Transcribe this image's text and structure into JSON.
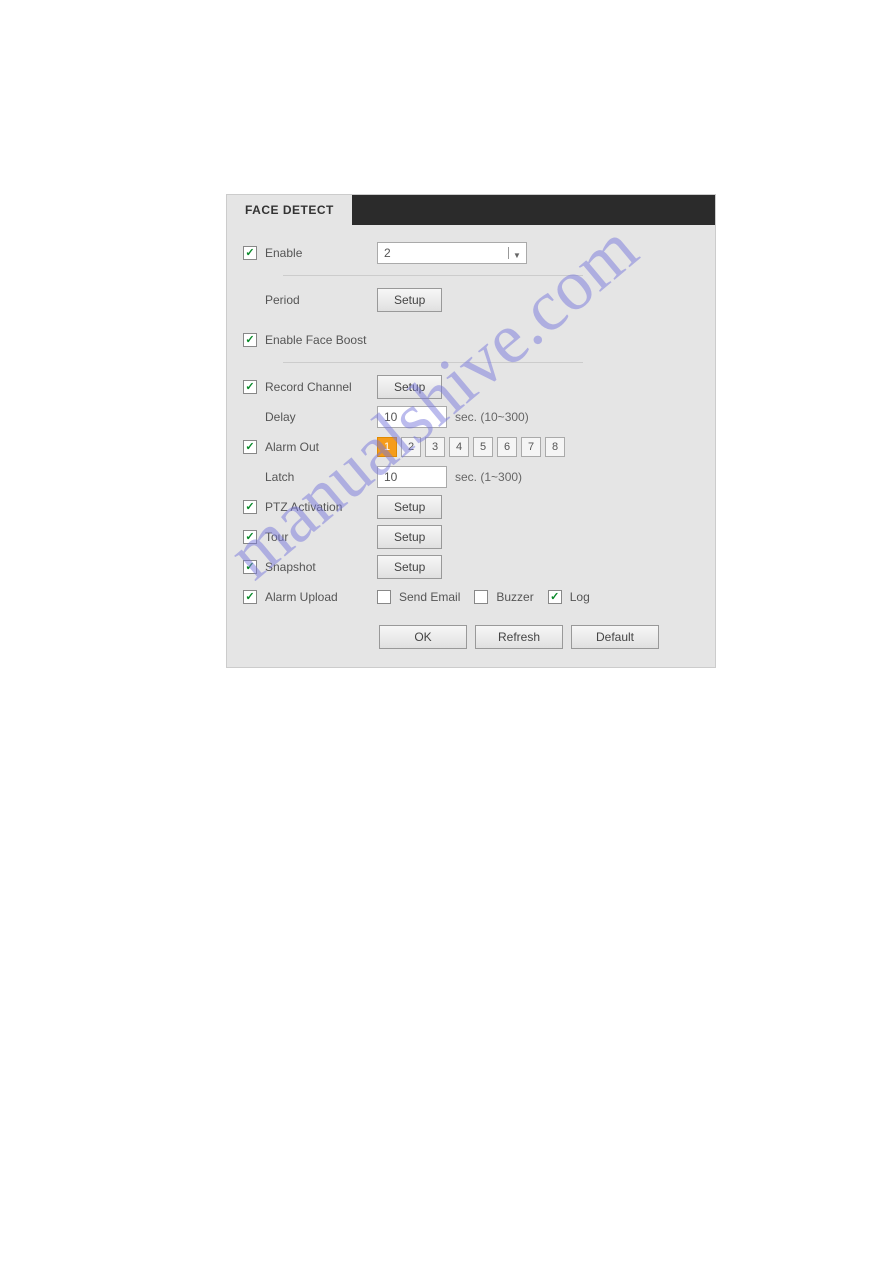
{
  "header": {
    "title": "FACE DETECT"
  },
  "enable": {
    "label": "Enable",
    "checked": true,
    "value": "2"
  },
  "period": {
    "label": "Period",
    "button": "Setup"
  },
  "faceBoost": {
    "label": "Enable Face Boost",
    "checked": true
  },
  "recordChannel": {
    "label": "Record Channel",
    "checked": true,
    "button": "Setup"
  },
  "delay": {
    "label": "Delay",
    "value": "10",
    "unit": "sec. (10~300)"
  },
  "alarmOut": {
    "label": "Alarm Out",
    "checked": true,
    "options": [
      "1",
      "2",
      "3",
      "4",
      "5",
      "6",
      "7",
      "8"
    ],
    "selected": 0
  },
  "latch": {
    "label": "Latch",
    "value": "10",
    "unit": "sec. (1~300)"
  },
  "ptz": {
    "label": "PTZ Activation",
    "checked": true,
    "button": "Setup"
  },
  "tour": {
    "label": "Tour",
    "checked": true,
    "button": "Setup"
  },
  "snapshot": {
    "label": "Snapshot",
    "checked": true,
    "button": "Setup"
  },
  "alarmUpload": {
    "label": "Alarm Upload",
    "checked": true,
    "sendEmail": {
      "label": "Send Email",
      "checked": false
    },
    "buzzer": {
      "label": "Buzzer",
      "checked": false
    },
    "log": {
      "label": "Log",
      "checked": true
    }
  },
  "footer": {
    "ok": "OK",
    "refresh": "Refresh",
    "default": "Default"
  },
  "watermark": "manualshive.com"
}
